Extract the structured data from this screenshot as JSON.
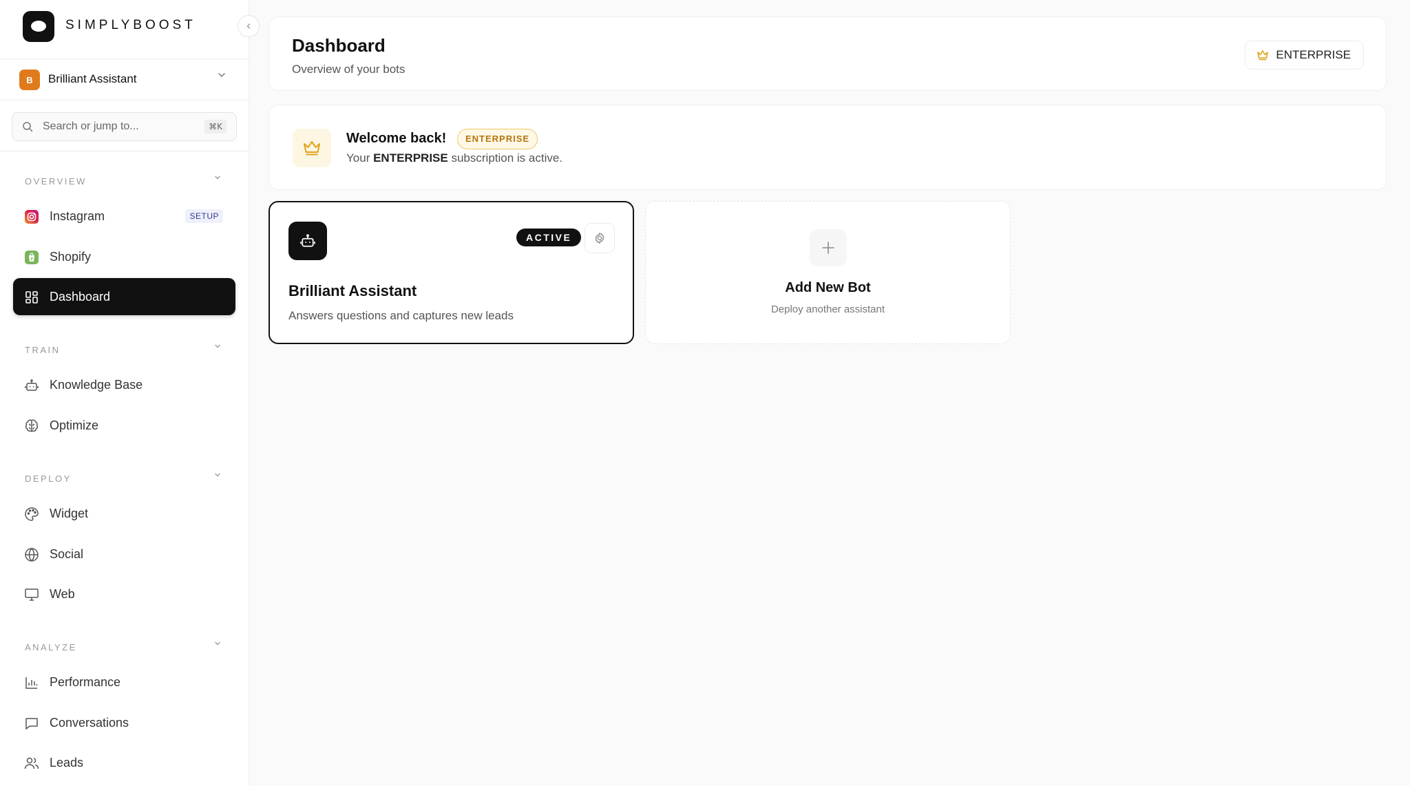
{
  "brand": {
    "name": "SIMPLYBOOST"
  },
  "bot_switcher": {
    "initial": "B",
    "name": "Brilliant Assistant",
    "avatar_color": "#e07b1d"
  },
  "search": {
    "placeholder": "Search or jump to...",
    "shortcut": "⌘K"
  },
  "sidebar": {
    "sections": [
      {
        "title": "OVERVIEW",
        "items": [
          {
            "label": "Instagram",
            "icon": "instagram-icon",
            "badge": "SETUP"
          },
          {
            "label": "Shopify",
            "icon": "shopify-icon"
          },
          {
            "label": "Dashboard",
            "icon": "grid-icon",
            "active": true
          }
        ]
      },
      {
        "title": "TRAIN",
        "items": [
          {
            "label": "Knowledge Base",
            "icon": "bot-icon"
          },
          {
            "label": "Optimize",
            "icon": "brain-icon"
          }
        ]
      },
      {
        "title": "DEPLOY",
        "items": [
          {
            "label": "Widget",
            "icon": "palette-icon"
          },
          {
            "label": "Social",
            "icon": "globe-icon"
          },
          {
            "label": "Web",
            "icon": "monitor-icon"
          }
        ]
      },
      {
        "title": "ANALYZE",
        "items": [
          {
            "label": "Performance",
            "icon": "bar-chart-icon"
          },
          {
            "label": "Conversations",
            "icon": "message-square-icon"
          },
          {
            "label": "Leads",
            "icon": "users-icon"
          }
        ]
      }
    ]
  },
  "header": {
    "title": "Dashboard",
    "subtitle": "Overview of your bots",
    "plan_label": "ENTERPRISE"
  },
  "welcome": {
    "title": "Welcome back!",
    "badge": "ENTERPRISE",
    "text_prefix": "Your",
    "text_plan": "ENTERPRISE",
    "text_suffix": "subscription is active."
  },
  "bots": [
    {
      "name": "Brilliant Assistant",
      "description": "Answers questions and captures new leads",
      "status": "ACTIVE"
    }
  ],
  "add_bot": {
    "title": "Add New Bot",
    "subtitle": "Deploy another assistant"
  },
  "colors": {
    "accent": "#111111",
    "gold": "#e0a21a",
    "enterprise_text": "#b5750c"
  }
}
